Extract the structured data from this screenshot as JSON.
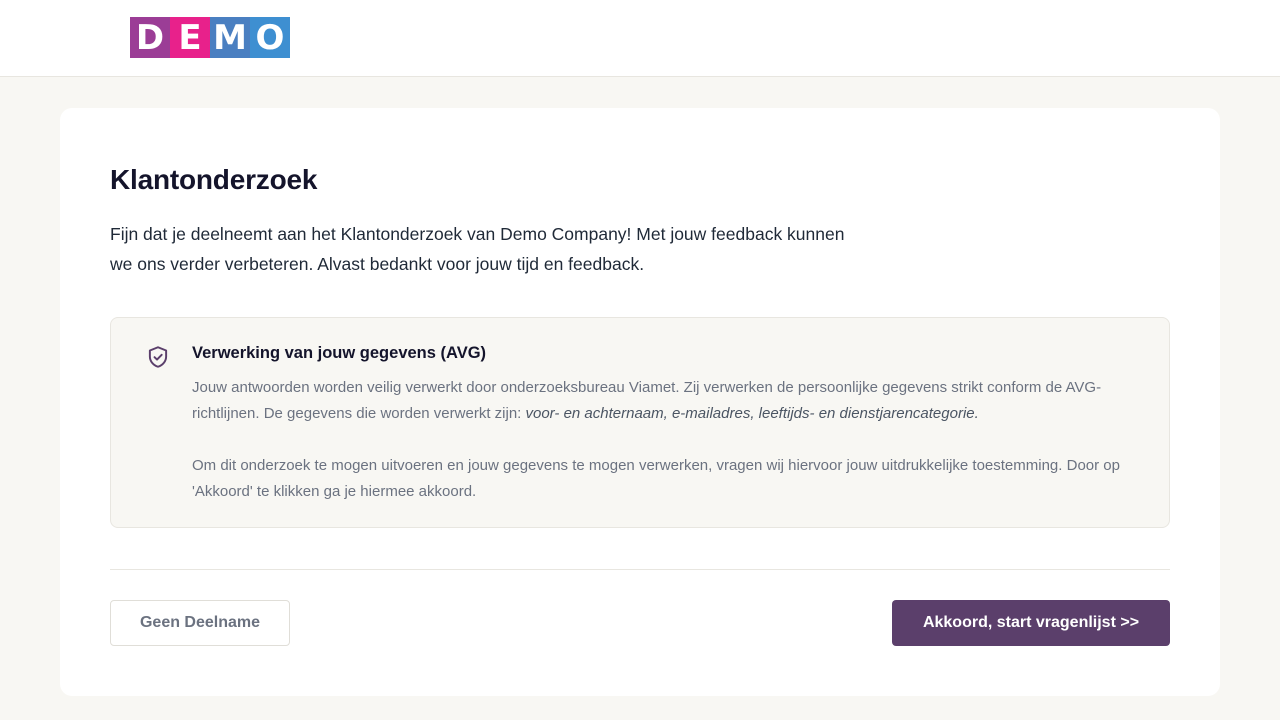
{
  "logo": {
    "letters": [
      "D",
      "E",
      "M",
      "O"
    ],
    "colors": [
      "#9b3d96",
      "#e8218b",
      "#4a7fc1",
      "#3e8fd1"
    ]
  },
  "main": {
    "title": "Klantonderzoek",
    "intro_line1": "Fijn dat je deelneemt aan het Klantonderzoek van Demo Company! Met jouw feedback kunnen",
    "intro_line2": "we ons verder verbeteren. Alvast bedankt voor jouw tijd en feedback."
  },
  "avg": {
    "icon": "shield-check-icon",
    "title": "Verwerking van jouw gegevens (AVG)",
    "p1_text": "Jouw antwoorden worden veilig verwerkt door onderzoeksbureau Viamet. Zij verwerken de persoonlijke gegevens strikt conform de AVG-richtlijnen. De gegevens die worden verwerkt zijn: ",
    "p1_italic": "voor- en achternaam, e-mailadres, leeftijds- en dienstjarencategorie.",
    "p2_text": "Om dit onderzoek te mogen uitvoeren en jouw gegevens te mogen verwerken, vragen wij hiervoor jouw uitdrukkelijke toestemming. Door op 'Akkoord' te klikken ga je hiermee akkoord."
  },
  "actions": {
    "decline_label": "Geen Deelname",
    "accept_label": "Akkoord, start vragenlijst >>",
    "accent_color": "#5b3f6b"
  }
}
